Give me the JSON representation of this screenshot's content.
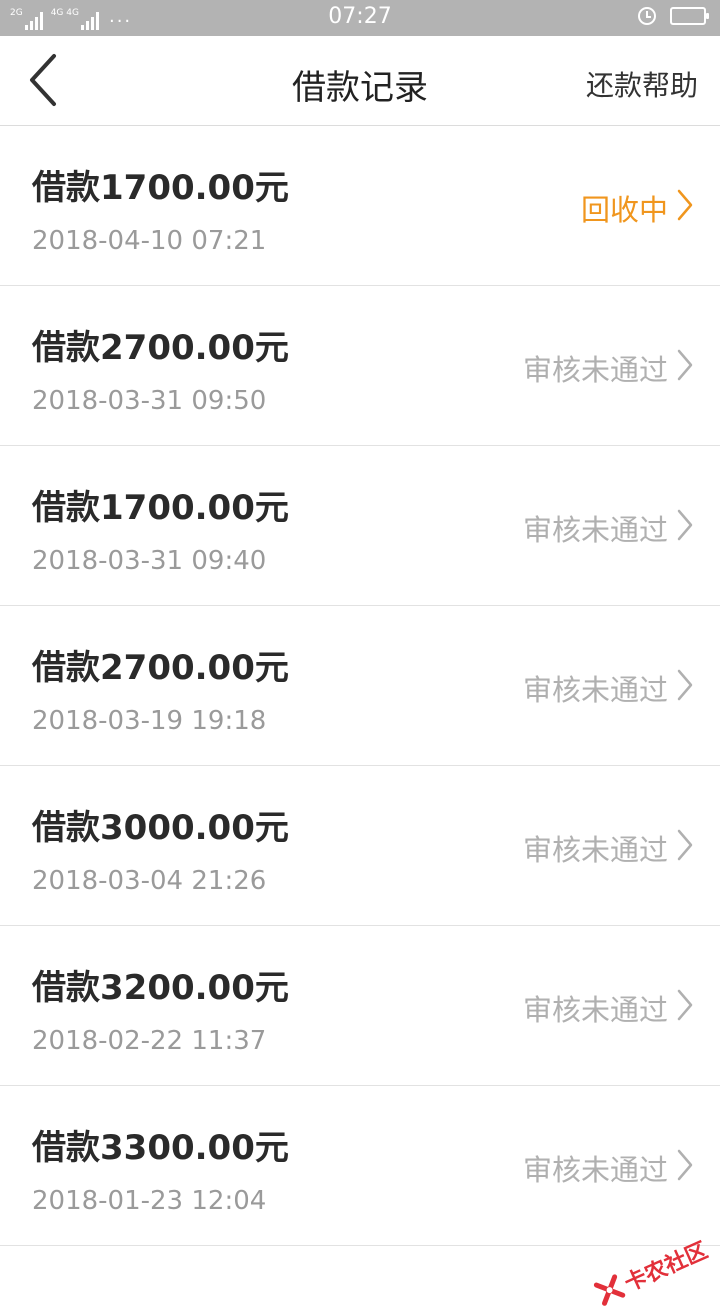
{
  "status_bar": {
    "net1": "2G",
    "net2": "4G 4G",
    "dots": "···",
    "time": "07:27"
  },
  "header": {
    "title": "借款记录",
    "help": "还款帮助"
  },
  "records": [
    {
      "amount": "借款1700.00元",
      "date": "2018-04-10 07:21",
      "status": "回收中"
    },
    {
      "amount": "借款2700.00元",
      "date": "2018-03-31 09:50",
      "status": "审核未通过"
    },
    {
      "amount": "借款1700.00元",
      "date": "2018-03-31 09:40",
      "status": "审核未通过"
    },
    {
      "amount": "借款2700.00元",
      "date": "2018-03-19 19:18",
      "status": "审核未通过"
    },
    {
      "amount": "借款3000.00元",
      "date": "2018-03-04 21:26",
      "status": "审核未通过"
    },
    {
      "amount": "借款3200.00元",
      "date": "2018-02-22 11:37",
      "status": "审核未通过"
    },
    {
      "amount": "借款3300.00元",
      "date": "2018-01-23 12:04",
      "status": "审核未通过"
    }
  ],
  "colors": {
    "active_status": "#f0961e",
    "inactive_status": "#b0b0b0",
    "statusbar_bg": "#b3b3b3"
  },
  "watermark": "卡农社区"
}
